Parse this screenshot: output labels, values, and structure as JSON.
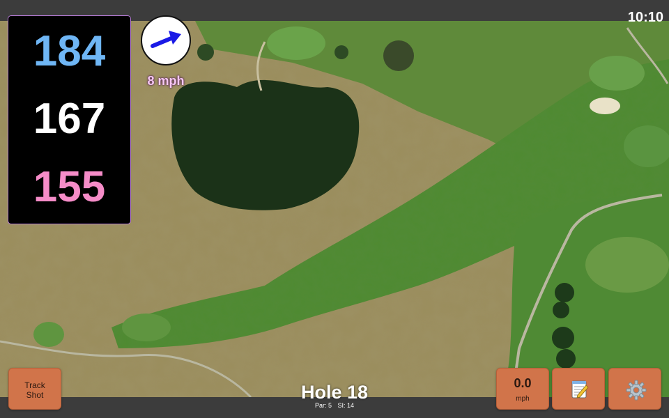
{
  "status_bar": {
    "time": "10:10"
  },
  "distances": {
    "back": "184",
    "middle": "167",
    "front": "155",
    "colors": {
      "back": "#6fb6f5",
      "middle": "#ffffff",
      "front": "#f58cc8"
    }
  },
  "wind": {
    "speed_label": "8 mph",
    "icon": "wind-direction-arrow-icon",
    "arrow_color": "#1a1ae6"
  },
  "hole": {
    "title": "Hole 18",
    "par": "Par: 5",
    "stroke_index": "SI: 14"
  },
  "buttons": {
    "track_shot": "Track\nShot",
    "speed_value": "0.0",
    "speed_unit": "mph",
    "notes_icon": "notepad-icon",
    "settings_icon": "gear-icon",
    "button_color": "#d1744a"
  },
  "map": {
    "type": "satellite-aerial-golf-hole"
  }
}
